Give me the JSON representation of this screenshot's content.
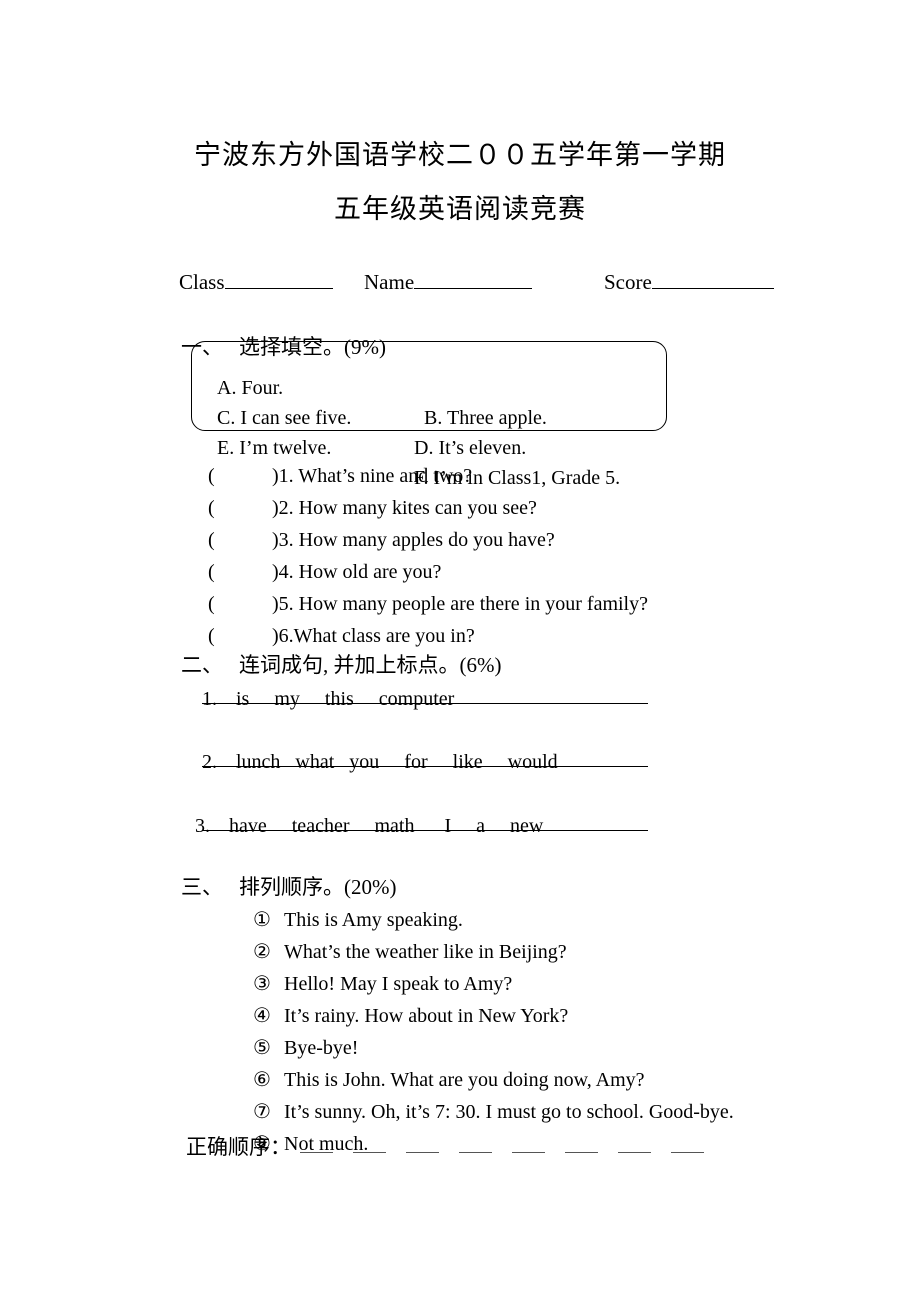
{
  "document": {
    "title_line_1": "宁波东方外国语学校二００五学年第一学期",
    "title_line_2": "五年级英语阅读竞赛"
  },
  "header_fields": {
    "class_label": "Class",
    "name_label": "Name",
    "score_label": "Score",
    "class_value": "",
    "name_value": "",
    "score_value": ""
  },
  "sections": [
    {
      "number": "一、",
      "heading": "选择填空。(9%)",
      "options_box": [
        {
          "left": "A. Four.",
          "right": "B. Three apple."
        },
        {
          "left": "C. I can see five.",
          "right": "D. It’s eleven."
        },
        {
          "left": "E. I’m twelve.",
          "right": "F. I’m in Class1, Grade 5."
        }
      ],
      "questions": [
        {
          "bracket_open": "(",
          "bracket_close": ")",
          "text": "1. What’s nine and two?",
          "answer": ""
        },
        {
          "bracket_open": "(",
          "bracket_close": ")",
          "text": "2. How many kites can you see?",
          "answer": ""
        },
        {
          "bracket_open": "(",
          "bracket_close": ")",
          "text": "3. How many apples do you have?",
          "answer": ""
        },
        {
          "bracket_open": "(",
          "bracket_close": ")",
          "text": "4. How old are you?",
          "answer": ""
        },
        {
          "bracket_open": "(",
          "bracket_close": ")",
          "text": "5. How many people are there in your family?",
          "answer": ""
        },
        {
          "bracket_open": "(",
          "bracket_close": ")",
          "text": "6.What class are you in?",
          "answer": ""
        }
      ]
    },
    {
      "number": "二、",
      "heading": "连词成句, 并加上标点。(6%)",
      "items": [
        {
          "num": "1.",
          "words": "is     my     this     computer",
          "answer": ""
        },
        {
          "num": "2.",
          "words": "lunch   what   you     for     like     would",
          "answer": ""
        },
        {
          "num": "3.",
          "words": "have     teacher     math      I     a     new",
          "answer": ""
        }
      ]
    },
    {
      "number": "三、",
      "heading": "排列顺序。(20%)",
      "items": [
        {
          "circle": "①",
          "text": "This is Amy speaking."
        },
        {
          "circle": "②",
          "text": "What’s the weather like in Beijing?"
        },
        {
          "circle": "③",
          "text": "Hello! May I speak to Amy?"
        },
        {
          "circle": "④",
          "text": "It’s rainy. How about in New York?"
        },
        {
          "circle": "⑤",
          "text": "Bye-bye!"
        },
        {
          "circle": "⑥",
          "text": "This is John. What are you doing now, Amy?"
        },
        {
          "circle": "⑦",
          "text": "It’s sunny. Oh, it’s 7: 30. I must go to school. Good-bye."
        },
        {
          "circle": "⑧",
          "text": "Not much."
        }
      ],
      "answer_label": "正确顺序：",
      "answer_blank_count": 8,
      "answers": [
        "",
        "",
        "",
        "",
        "",
        "",
        "",
        ""
      ]
    }
  ]
}
